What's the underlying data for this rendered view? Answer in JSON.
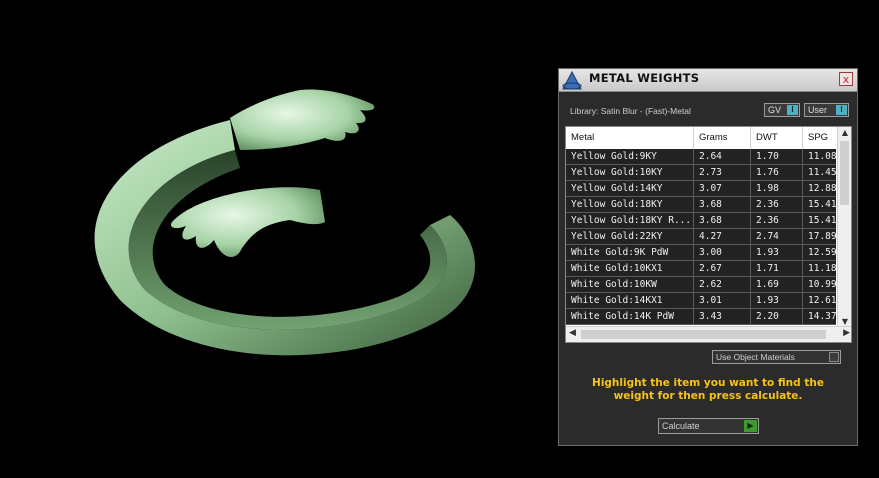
{
  "panel": {
    "title": "METAL WEIGHTS",
    "close_label": "x",
    "library_label": "Library: Satin Blur - (Fast)-Metal",
    "toggles": [
      {
        "label": "GV",
        "state_symbol": "I"
      },
      {
        "label": "User",
        "state_symbol": "I"
      }
    ],
    "table": {
      "headers": [
        "Metal",
        "Grams",
        "DWT",
        "SPG"
      ],
      "rows": [
        [
          "Yellow Gold:9KY",
          "2.64",
          "1.70",
          "11.08"
        ],
        [
          "Yellow Gold:10KY",
          "2.73",
          "1.76",
          "11.45"
        ],
        [
          "Yellow Gold:14KY",
          "3.07",
          "1.98",
          "12.88"
        ],
        [
          "Yellow Gold:18KY",
          "3.68",
          "2.36",
          "15.41"
        ],
        [
          "Yellow Gold:18KY R...",
          "3.68",
          "2.36",
          "15.41"
        ],
        [
          "Yellow Gold:22KY",
          "4.27",
          "2.74",
          "17.89"
        ],
        [
          "White Gold:9K PdW",
          "3.00",
          "1.93",
          "12.59"
        ],
        [
          "White Gold:10KX1",
          "2.67",
          "1.71",
          "11.18"
        ],
        [
          "White Gold:10KW",
          "2.62",
          "1.69",
          "10.99"
        ],
        [
          "White Gold:14KX1",
          "3.01",
          "1.93",
          "12.61"
        ],
        [
          "White Gold:14K PdW",
          "3.43",
          "2.20",
          "14.37"
        ]
      ]
    },
    "use_object_materials_label": "Use Object Materials",
    "instruction": "Highlight the item you want to find the weight for then press calculate.",
    "calculate_label": "Calculate"
  },
  "colors": {
    "background": "#000000",
    "ring": "#a8d7a8",
    "instruction": "#f7c31a",
    "toggle_knob": "#4fb0c4",
    "calculate_go": "#3e9a2c"
  }
}
